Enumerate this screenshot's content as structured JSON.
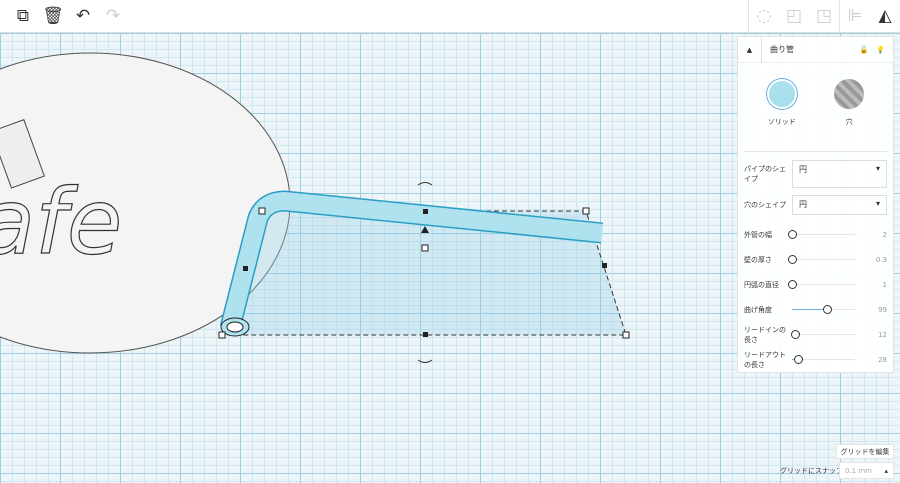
{
  "toolbar": {
    "icons": [
      "copy-icon",
      "trash-icon",
      "undo-icon",
      "redo-icon",
      "light-bulb-icon",
      "note-icon",
      "shape-icon",
      "align-icon",
      "mirror-icon"
    ]
  },
  "shape_panel": {
    "title": "曲り管",
    "solid_label": "ソリッド",
    "hole_label": "穴",
    "selects": [
      {
        "label": "パイプのシェイプ",
        "value": "円"
      },
      {
        "label": "穴のシェイプ",
        "value": "円"
      }
    ],
    "sliders": [
      {
        "label": "外管の幅",
        "value": "2",
        "fraction": 0.0
      },
      {
        "label": "壁の厚さ",
        "value": "0.3",
        "fraction": 0.0
      },
      {
        "label": "円弧の直径",
        "value": "1",
        "fraction": 0.0
      },
      {
        "label": "曲げ角度",
        "value": "99",
        "fraction": 0.55
      },
      {
        "label": "リードインの長さ",
        "value": "12",
        "fraction": 0.05
      },
      {
        "label": "リードアウトの長さ",
        "value": "28",
        "fraction": 0.1
      }
    ]
  },
  "grid": {
    "edit_label": "グリッドを編集",
    "snap_label": "グリッドにスナップ",
    "snap_value": "0.1 mm"
  },
  "logo_text": "afe",
  "colors": {
    "solid": "#a8e0ec",
    "accent": "#6aaee0"
  }
}
